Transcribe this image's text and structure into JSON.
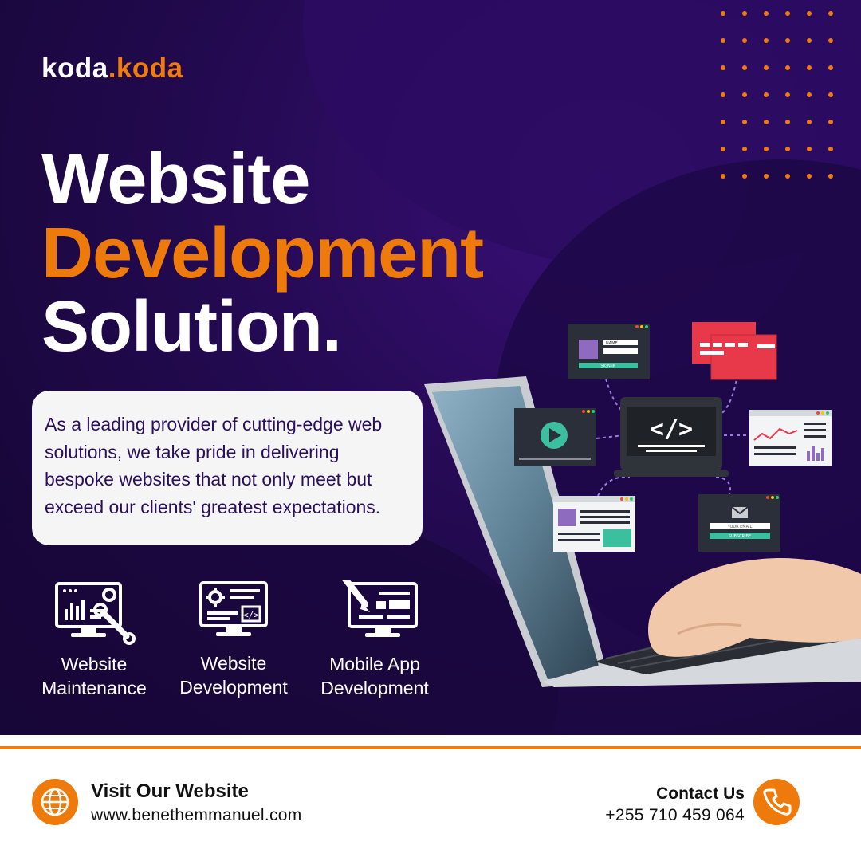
{
  "brand": {
    "part1": "koda",
    "part2": ".koda"
  },
  "headline": {
    "line1": "Website",
    "line2": "Development",
    "line3": "Solution."
  },
  "description": "As a leading provider of cutting-edge web solutions, we take pride in delivering bespoke websites that not only meet but exceed our clients' greatest expectations.",
  "services": [
    {
      "line1": "Website",
      "line2": "Maintenance",
      "icon": "monitor-wrench-icon"
    },
    {
      "line1": "Website",
      "line2": "Development",
      "icon": "monitor-gear-code-icon"
    },
    {
      "line1": "Mobile App",
      "line2": "Development",
      "icon": "monitor-pen-icon"
    }
  ],
  "illustration": {
    "code_symbol": "</>",
    "login_field_1": "NAME",
    "login_button": "SIGN IN",
    "email_field": "YOUR EMAIL",
    "subscribe_button": "SUBSCRIBE"
  },
  "footer": {
    "website_title": "Visit Our Website",
    "website_url": "www.benethemmanuel.com",
    "contact_title": "Contact Us",
    "contact_phone": "+255 710 459 064"
  },
  "colors": {
    "accent": "#f07c0e",
    "background": "#240a52",
    "text_dark": "#2c0f5c"
  }
}
